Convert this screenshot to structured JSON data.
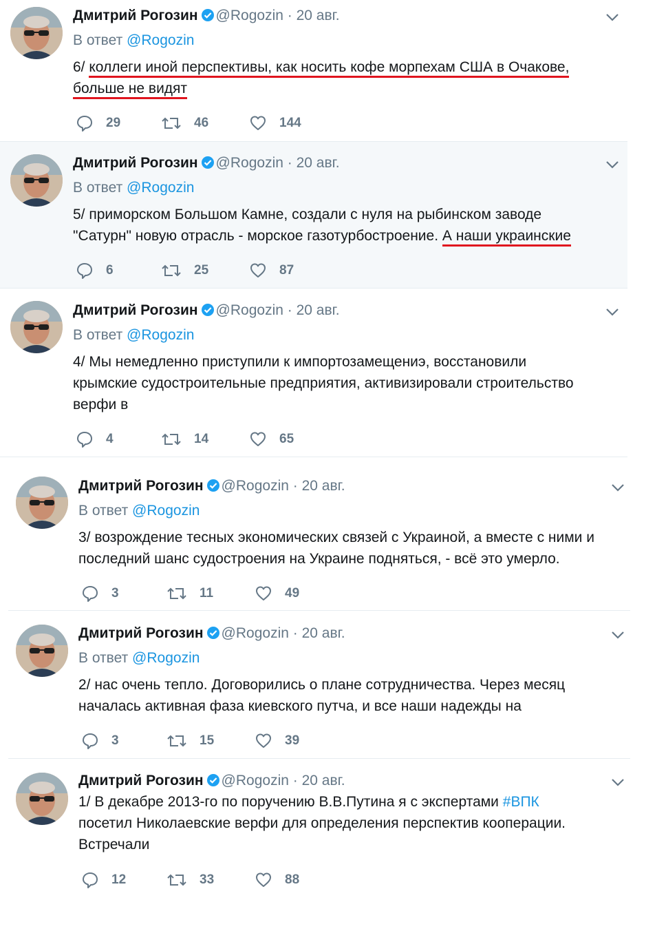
{
  "colors": {
    "link": "#1b95e0",
    "muted": "#657786",
    "underline": "#e0141e",
    "highlight_bg": "#f5f8fa"
  },
  "tweets": [
    {
      "name": "Дмитрий Рогозин",
      "handle": "@Rogozin",
      "dot": "·",
      "date": "20 авг.",
      "reply_prefix": "В ответ",
      "reply_mention": "@Rogozin",
      "line1_pre": "6/ ",
      "line1_u": "коллеги иной перспективы, как носить кофе морпехам США в Очакове,",
      "line2_u": "больше не видят",
      "replies": "29",
      "retweets": "46",
      "likes": "144"
    },
    {
      "name": "Дмитрий Рогозин",
      "handle": "@Rogozin",
      "dot": "·",
      "date": "20 авг.",
      "reply_prefix": "В ответ",
      "reply_mention": "@Rogozin",
      "line1": "5/ приморском Большом Камне, создали с нуля на рыбинском заводе",
      "line2_pre": "\"Сатурн\" новую отрасль - морское газотурбостроение. ",
      "line2_u": "А наши украинские",
      "replies": "6",
      "retweets": "25",
      "likes": "87"
    },
    {
      "name": "Дмитрий Рогозин",
      "handle": "@Rogozin",
      "dot": "·",
      "date": "20 авг.",
      "reply_prefix": "В ответ",
      "reply_mention": "@Rogozin",
      "line1": "4/ Мы немедленно приступили к импортозамещениэ, восстановили",
      "line2": "крымские судостроительные предприятия, активизировали строительство",
      "line3": "верфи в",
      "replies": "4",
      "retweets": "14",
      "likes": "65"
    },
    {
      "name": "Дмитрий Рогозин",
      "handle": "@Rogozin",
      "dot": "·",
      "date": "20 авг.",
      "reply_prefix": "В ответ",
      "reply_mention": "@Rogozin",
      "line1": "3/ возрождение тесных экономических связей с Украиной, а вместе с ними и",
      "line2": "последний шанс судостроения на Украине подняться, - всё это умерло.",
      "replies": "3",
      "retweets": "11",
      "likes": "49"
    },
    {
      "name": "Дмитрий Рогозин",
      "handle": "@Rogozin",
      "dot": "·",
      "date": "20 авг.",
      "reply_prefix": "В ответ",
      "reply_mention": "@Rogozin",
      "line1": "2/ нас очень тепло. Договорились о плане сотрудничества. Через месяц",
      "line2": "началась активная фаза киевского путча, и все наши надежды на",
      "replies": "3",
      "retweets": "15",
      "likes": "39"
    },
    {
      "name": "Дмитрий Рогозин",
      "handle": "@Rogozin",
      "dot": "·",
      "date": "20 авг.",
      "line1_pre": "1/ В декабре 2013-го по поручению В.В.Путина я с экспертами ",
      "line1_tag": "#ВПК",
      "line2": "посетил Николаевские верфи для определения перспектив кооперации.",
      "line3": "Встречали",
      "replies": "12",
      "retweets": "33",
      "likes": "88"
    }
  ]
}
